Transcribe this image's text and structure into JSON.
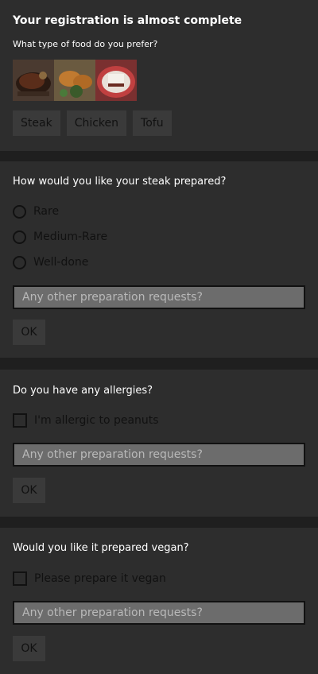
{
  "header": {
    "title": "Your registration is almost complete",
    "question": "What type of food do you prefer?"
  },
  "food_images": [
    "steak-image",
    "chicken-image",
    "tofu-image"
  ],
  "food_options": [
    "Steak",
    "Chicken",
    "Tofu"
  ],
  "steak": {
    "question": "How would you like your steak prepared?",
    "options": [
      "Rare",
      "Medium-Rare",
      "Well-done"
    ],
    "placeholder": "Any other preparation requests?",
    "ok": "OK"
  },
  "allergy": {
    "question": "Do you have any allergies?",
    "option": "I'm allergic to peanuts",
    "placeholder": "Any other preparation requests?",
    "ok": "OK"
  },
  "vegan": {
    "question": "Would you like it prepared vegan?",
    "option": "Please prepare it vegan",
    "placeholder": "Any other preparation requests?",
    "ok": "OK"
  }
}
